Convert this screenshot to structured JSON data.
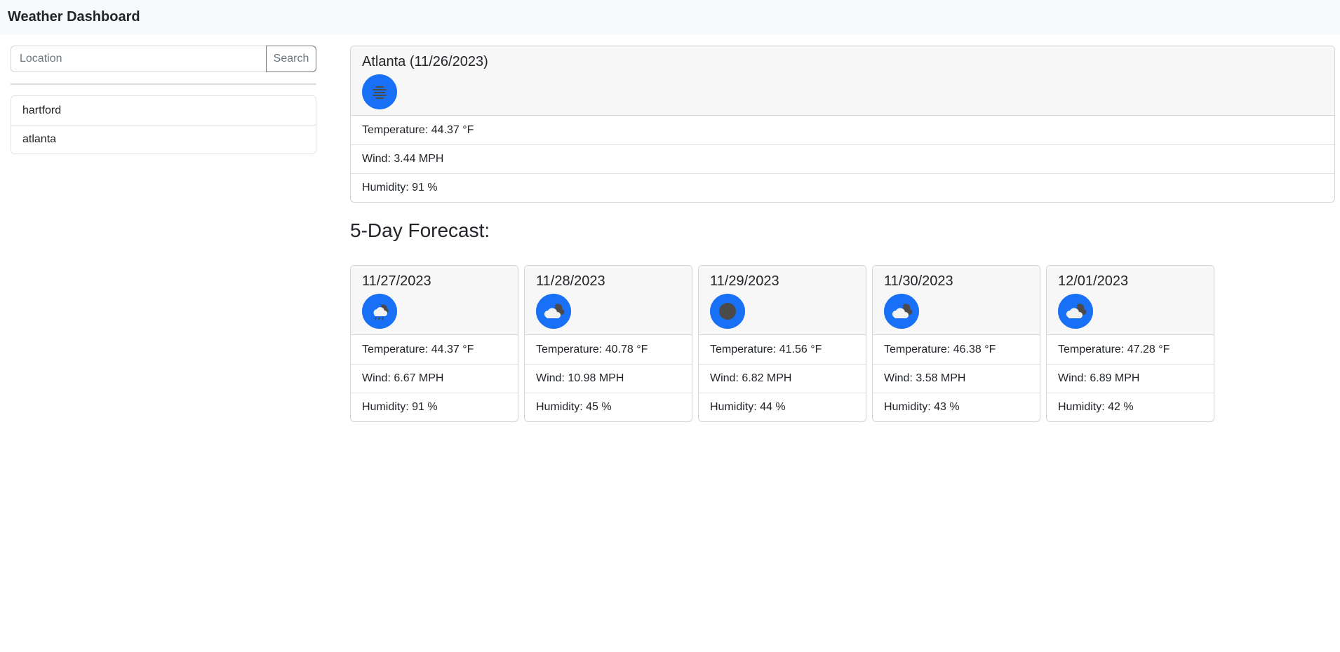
{
  "app": {
    "title": "Weather Dashboard"
  },
  "search": {
    "placeholder": "Location",
    "value": "",
    "button_label": "Search"
  },
  "history": [
    {
      "label": "hartford"
    },
    {
      "label": "atlanta"
    }
  ],
  "current": {
    "title": "Atlanta (11/26/2023)",
    "icon": "mist-icon",
    "temperature": "Temperature: 44.37 °F",
    "wind": "Wind: 3.44 MPH",
    "humidity": "Humidity: 91 %"
  },
  "forecast_heading": "5-Day Forecast:",
  "forecast": [
    {
      "date": "11/27/2023",
      "icon": "rain-cloud-icon",
      "temperature": "Temperature: 44.37 °F",
      "wind": "Wind: 6.67 MPH",
      "humidity": "Humidity: 91 %"
    },
    {
      "date": "11/28/2023",
      "icon": "broken-clouds-icon",
      "temperature": "Temperature: 40.78 °F",
      "wind": "Wind: 10.98 MPH",
      "humidity": "Humidity: 45 %"
    },
    {
      "date": "11/29/2023",
      "icon": "overcast-icon",
      "temperature": "Temperature: 41.56 °F",
      "wind": "Wind: 6.82 MPH",
      "humidity": "Humidity: 44 %"
    },
    {
      "date": "11/30/2023",
      "icon": "broken-clouds-icon",
      "temperature": "Temperature: 46.38 °F",
      "wind": "Wind: 3.58 MPH",
      "humidity": "Humidity: 43 %"
    },
    {
      "date": "12/01/2023",
      "icon": "broken-clouds-icon",
      "temperature": "Temperature: 47.28 °F",
      "wind": "Wind: 6.89 MPH",
      "humidity": "Humidity: 42 %"
    }
  ],
  "colors": {
    "icon_background": "#1770f5",
    "header_background": "#f7f7f7",
    "navbar_background": "#f8f9fa"
  }
}
